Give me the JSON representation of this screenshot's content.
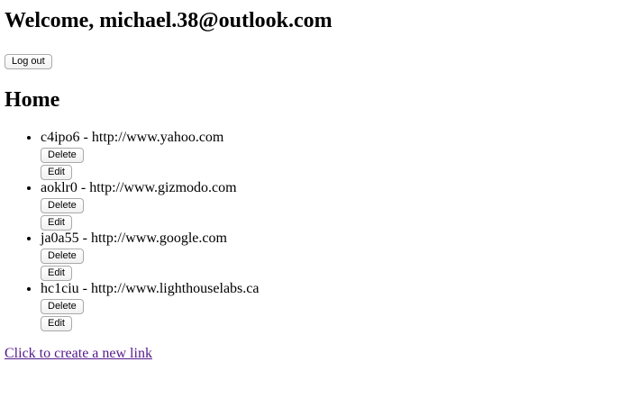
{
  "header": {
    "welcome": "Welcome, michael.38@outlook.com",
    "logout_label": "Log out"
  },
  "main": {
    "title": "Home",
    "items": [
      {
        "text": "c4ipo6 - http://www.yahoo.com",
        "delete_label": "Delete",
        "edit_label": "Edit"
      },
      {
        "text": "aoklr0 - http://www.gizmodo.com",
        "delete_label": "Delete",
        "edit_label": "Edit"
      },
      {
        "text": "ja0a55 - http://www.google.com",
        "delete_label": "Delete",
        "edit_label": "Edit"
      },
      {
        "text": "hc1ciu - http://www.lighthouselabs.ca",
        "delete_label": "Delete",
        "edit_label": "Edit"
      }
    ],
    "create_link": "Click to create a new link"
  },
  "colors": {
    "visited_link": "#551a8b"
  }
}
